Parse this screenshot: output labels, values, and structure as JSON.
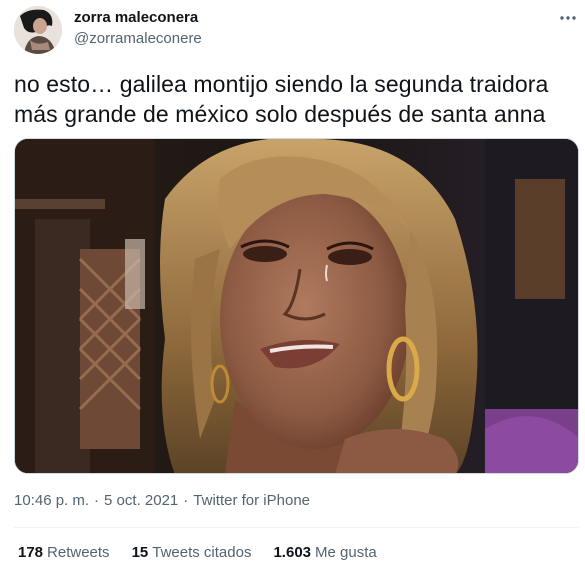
{
  "author": {
    "display_name": "zorra maleconera",
    "handle": "@zorramaleconere",
    "avatar_icon": "profile-photo"
  },
  "tweet": {
    "text": "no esto… galilea montijo siendo la segunda traidora más grande de méxico solo después de santa anna",
    "media_description_icon": "photo-attachment"
  },
  "meta": {
    "time": "10:46 p. m.",
    "separator": "·",
    "date": "5 oct. 2021",
    "separator2": "·",
    "source": "Twitter for iPhone"
  },
  "stats": {
    "retweets_count": "178",
    "retweets_label": "Retweets",
    "quotes_count": "15",
    "quotes_label": "Tweets citados",
    "likes_count": "1.603",
    "likes_label": "Me gusta"
  },
  "colors": {
    "text_primary": "#0f1419",
    "text_secondary": "#536471",
    "divider": "#eff3f4"
  }
}
